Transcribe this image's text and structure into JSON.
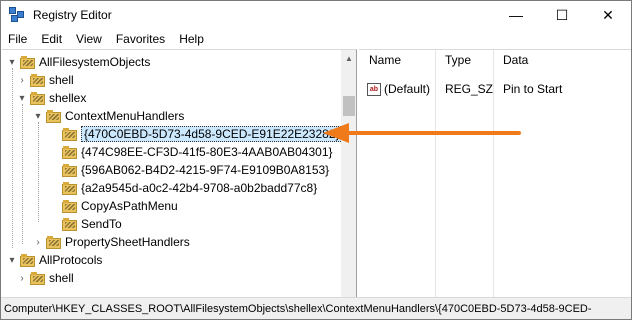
{
  "window": {
    "title": "Registry Editor",
    "controls": {
      "minimize": "—",
      "maximize": "☐",
      "close": "✕"
    }
  },
  "menu": [
    "File",
    "Edit",
    "View",
    "Favorites",
    "Help"
  ],
  "tree": [
    {
      "label": "AllFilesystemObjects",
      "expander": "▾",
      "selected": false
    },
    {
      "label": "shell",
      "expander": "›",
      "selected": false
    },
    {
      "label": "shellex",
      "expander": "▾",
      "selected": false
    },
    {
      "label": "ContextMenuHandlers",
      "expander": "▾",
      "selected": false
    },
    {
      "label": "{470C0EBD-5D73-4d58-9CED-E91E22E23282}",
      "expander": "",
      "selected": true
    },
    {
      "label": "{474C98EE-CF3D-41f5-80E3-4AAB0AB04301}",
      "expander": "",
      "selected": false
    },
    {
      "label": "{596AB062-B4D2-4215-9F74-E9109B0A8153}",
      "expander": "",
      "selected": false
    },
    {
      "label": "{a2a9545d-a0c2-42b4-9708-a0b2badd77c8}",
      "expander": "",
      "selected": false
    },
    {
      "label": "CopyAsPathMenu",
      "expander": "",
      "selected": false
    },
    {
      "label": "SendTo",
      "expander": "",
      "selected": false
    },
    {
      "label": "PropertySheetHandlers",
      "expander": "›",
      "selected": false
    },
    {
      "label": "AllProtocols",
      "expander": "▾",
      "selected": false
    },
    {
      "label": "shell",
      "expander": "›",
      "selected": false
    }
  ],
  "columns": {
    "name": "Name",
    "type": "Type",
    "data": "Data"
  },
  "values": [
    {
      "icon": "ab",
      "name": "(Default)",
      "type": "REG_SZ",
      "data": "Pin to Start"
    }
  ],
  "status_path": "Computer\\HKEY_CLASSES_ROOT\\AllFilesystemObjects\\shellex\\ContextMenuHandlers\\{470C0EBD-5D73-4d58-9CED-",
  "colors": {
    "accent_arrow": "#f07a1a",
    "selection": "#cce8ff",
    "folder": "#e8c25c"
  }
}
